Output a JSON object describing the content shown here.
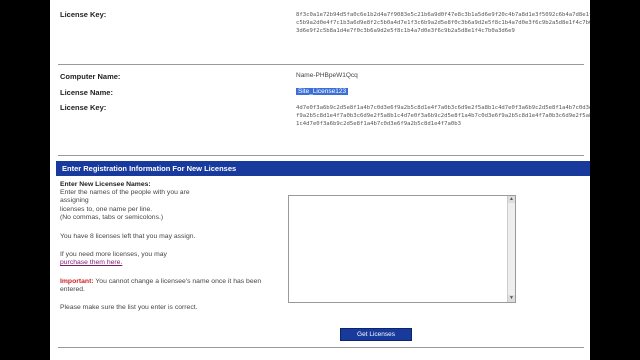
{
  "fields": {
    "license_key_label": "License Key:",
    "license_key_value": "8f3c0a1e72b94d5fa0c6e1b2d4a7f9083e5c21b6a9d0f47e8c3b1a5d6e9f20c4b7a8d1e3f5092c6b4a7d8e1f3c5b9a2d0e4f7c1b3a6d9e8f2c5b0a4d7e1f3c6b9a2d5e8f0c3b6a9d2e5f8c1b4a7d0e3f6c9b2a5d8e1f4c7b0a3d6e9f2c5b8a1d4e7f0c3b6a9d2e5f8c1b4a7d0e3f6c9b2a5d8e1f4c7b0a3d6e9",
    "computer_name_label": "Computer Name:",
    "computer_name_value": "Name-PHBpeW1Qcq",
    "license_name_label": "License Name:",
    "license_name_value": "Site_License123",
    "license_key2_label": "License Key:",
    "license_key2_value": "4d7e0f3a6b9c2d5e8f1a4b7c0d3e6f9a2b5c8d1e4f7a0b3c6d9e2f5a8b1c4d7e0f3a6b9c2d5e8f1a4b7c0d3e6f9a2b5c8d1e4f7a0b3c6d9e2f5a8b1c4d7e0f3a6b9c2d5e8f1a4b7c0d3e6f9a2b5c8d1e4f7a0b3c6d9e2f5a8b1c4d7e0f3a6b9c2d5e8f1a4b7c0d3e6f9a2b5c8d1e4f7a0b3"
  },
  "section": {
    "title": "Enter Registration Information For New Licenses"
  },
  "instructions": {
    "heading": "Enter New Licensee Names:",
    "line1": "Enter the names of the people with you are",
    "line2": "assigning",
    "line3": "licenses to, one name per line.",
    "line4": "(No commas, tabs or semicolons.)",
    "licenses_left": "You have 8 licenses left that you may assign.",
    "purchase_text": "If you need more licenses, you may",
    "purchase_link": "purchase them here.",
    "important_label": "Important:",
    "important_text": "You cannot change a licensee's name once it has been entered.",
    "confirm": "Please make sure the list you enter is correct."
  },
  "textarea": {
    "value": ""
  },
  "button": {
    "label": "Get Licenses"
  }
}
